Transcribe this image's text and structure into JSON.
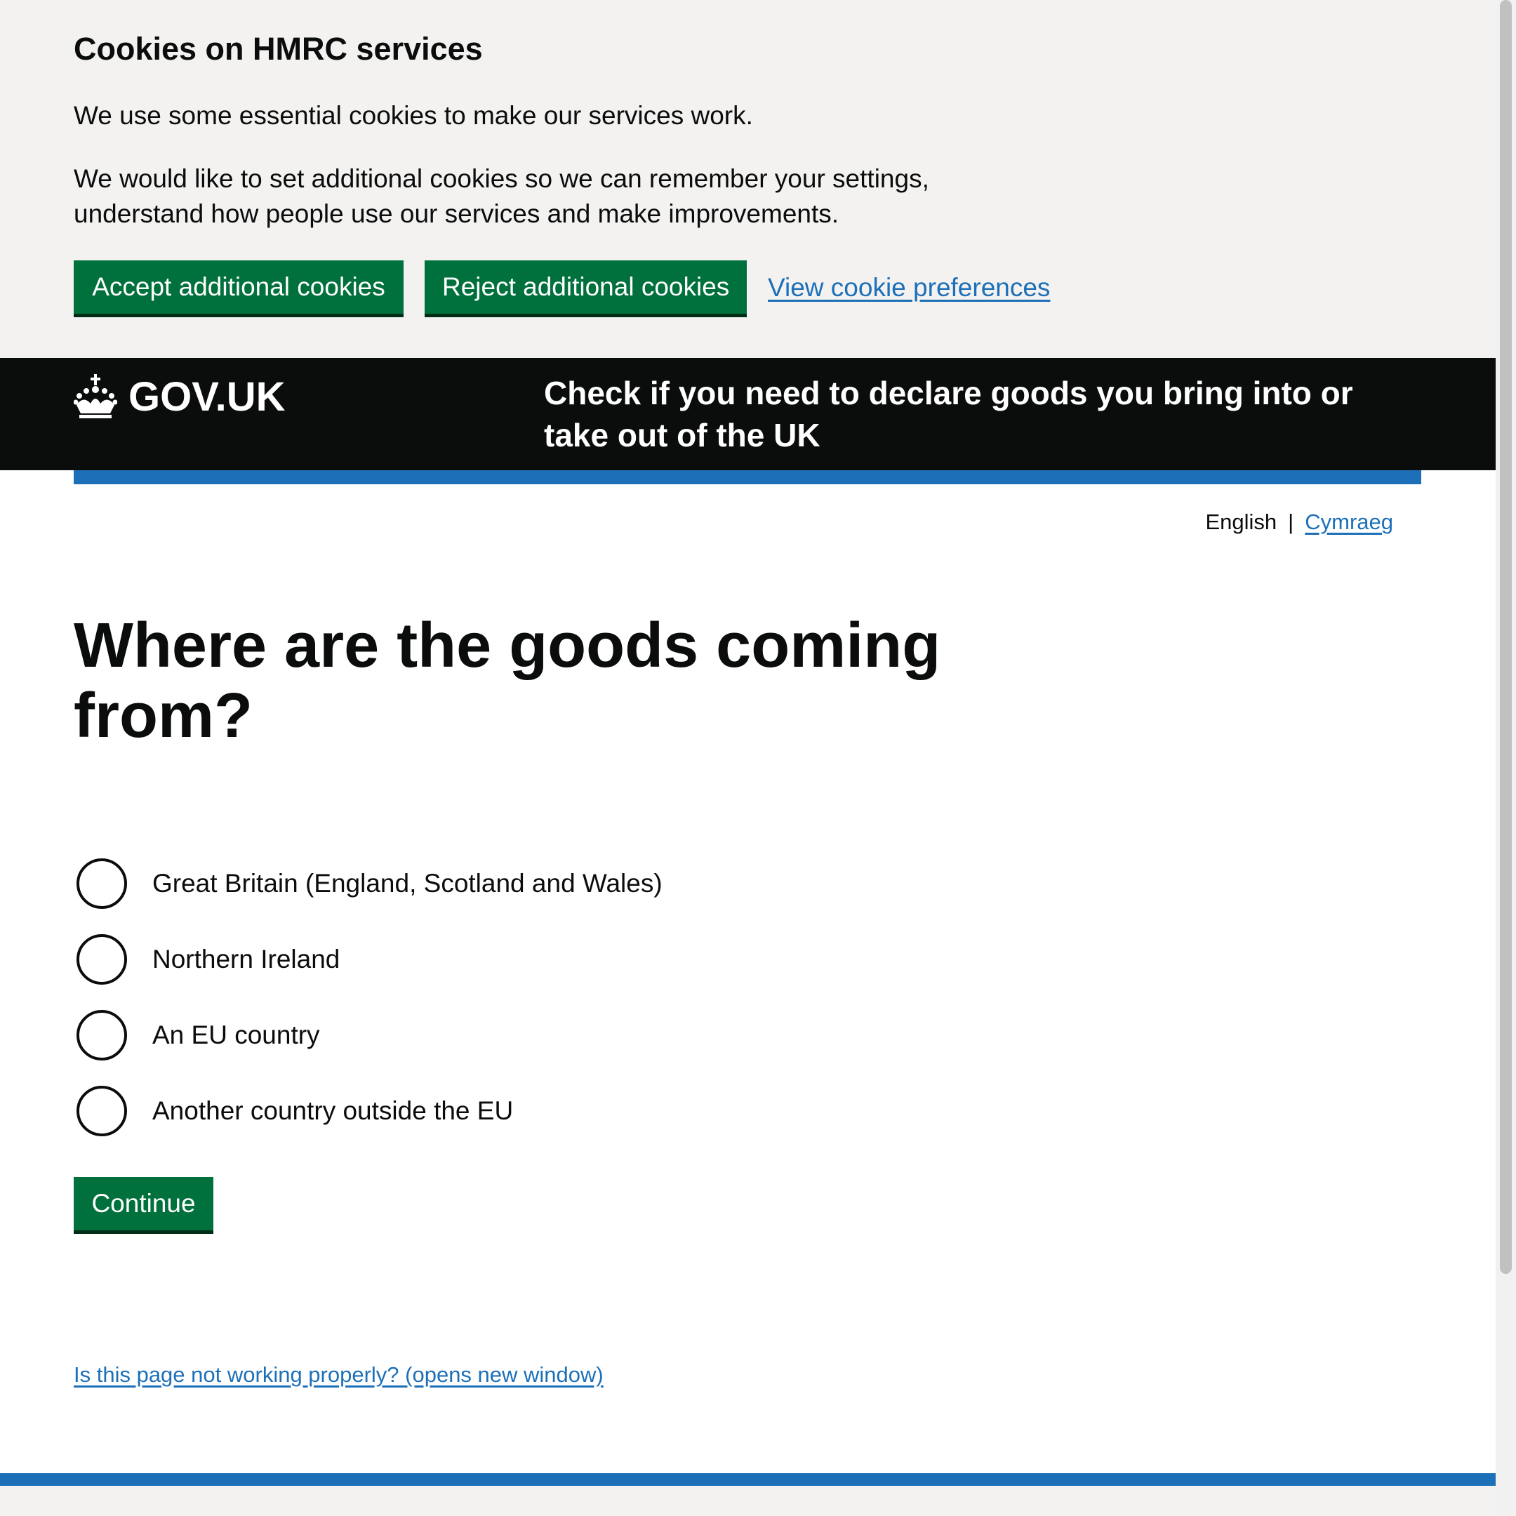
{
  "cookie_banner": {
    "title": "Cookies on HMRC services",
    "paragraph_1": "We use some essential cookies to make our services work.",
    "paragraph_2": "We would like to set additional cookies so we can remember your settings, understand how people use our services and make improvements.",
    "accept_label": "Accept additional cookies",
    "reject_label": "Reject additional cookies",
    "preferences_link": "View cookie preferences"
  },
  "header": {
    "logo_text": "GOV.UK",
    "logo_icon": "crown-icon",
    "service_name": "Check if you need to declare goods you bring into or take out of the UK"
  },
  "language": {
    "current": "English",
    "separator": "|",
    "alternate": "Cymraeg"
  },
  "main": {
    "heading": "Where are the goods coming from?",
    "options": [
      {
        "label": "Great Britain (England, Scotland and Wales)",
        "selected": false
      },
      {
        "label": "Northern Ireland",
        "selected": false
      },
      {
        "label": "An EU country",
        "selected": false
      },
      {
        "label": "Another country outside the EU",
        "selected": false
      }
    ],
    "continue_label": "Continue",
    "report_link": "Is this page not working properly? (opens new window)"
  },
  "colors": {
    "button_green": "#00703c",
    "link_blue": "#1d70b8",
    "header_black": "#0b0c0c",
    "banner_grey": "#f3f2f1"
  }
}
